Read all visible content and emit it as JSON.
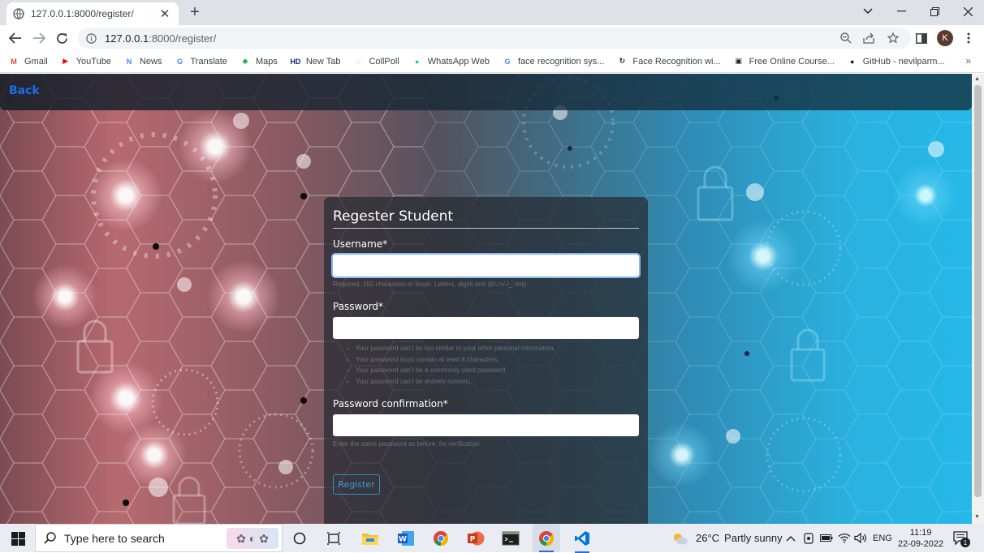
{
  "browser": {
    "tab_title": "127.0.0.1:8000/register/",
    "url_host": "127.0.0.1",
    "url_path": ":8000/register/",
    "profile_initial": "K",
    "bookmarks": [
      {
        "label": "Gmail",
        "icon": "gmail-icon",
        "color": "#ea4335",
        "glyph": "M"
      },
      {
        "label": "YouTube",
        "icon": "youtube-icon",
        "color": "#ff0000",
        "glyph": "▶"
      },
      {
        "label": "News",
        "icon": "news-icon",
        "color": "#4285f4",
        "glyph": "N"
      },
      {
        "label": "Translate",
        "icon": "translate-icon",
        "color": "#4285f4",
        "glyph": "G"
      },
      {
        "label": "Maps",
        "icon": "maps-icon",
        "color": "#34a853",
        "glyph": "◆"
      },
      {
        "label": "New Tab",
        "icon": "hd-icon",
        "color": "#1a237e",
        "glyph": "HD"
      },
      {
        "label": "CollPoll",
        "icon": "collpoll-icon",
        "color": "#e53935",
        "glyph": "◌"
      },
      {
        "label": "WhatsApp Web",
        "icon": "whatsapp-icon",
        "color": "#25d366",
        "glyph": "●"
      },
      {
        "label": "face recognition sys...",
        "icon": "google-icon",
        "color": "#4285f4",
        "glyph": "G"
      },
      {
        "label": "Face Recognition wi...",
        "icon": "face-recognition-icon",
        "color": "#202124",
        "glyph": "↻"
      },
      {
        "label": "Free Online Course...",
        "icon": "course-icon",
        "color": "#202124",
        "glyph": "▣"
      },
      {
        "label": "GitHub - nevilparm...",
        "icon": "github-icon",
        "color": "#202124",
        "glyph": "●"
      }
    ]
  },
  "page": {
    "back_label": "Back",
    "form_title": "Regester Student",
    "username_label": "Username*",
    "username_value": "",
    "username_help": "Required. 150 characters or fewer. Letters, digits and @/./+/-/_ only.",
    "password_label": "Password*",
    "password_value": "",
    "password_rules": [
      "Your password can’t be too similar to your other personal information.",
      "Your password must contain at least 8 characters.",
      "Your password can’t be a commonly used password.",
      "Your password can’t be entirely numeric."
    ],
    "confirm_label": "Password confirmation*",
    "confirm_value": "",
    "confirm_help": "Enter the same password as before, for verification.",
    "submit_label": "Register"
  },
  "taskbar": {
    "search_placeholder": "Type here to search",
    "weather_temp": "26°C",
    "weather_text": "Partly sunny",
    "language": "ENG",
    "time": "11:19",
    "date": "22-09-2022",
    "notification_count": "1"
  }
}
